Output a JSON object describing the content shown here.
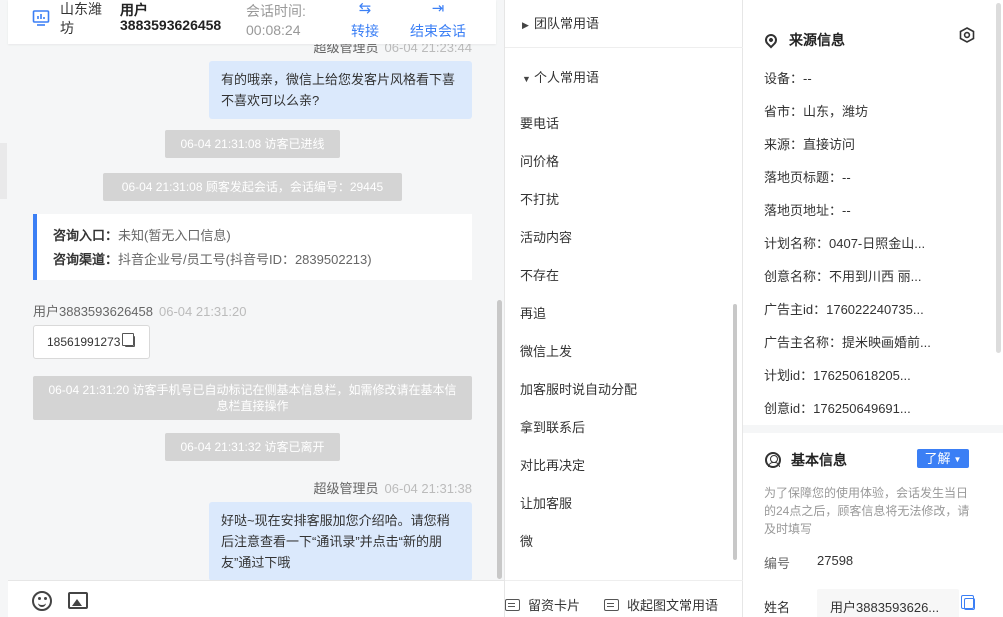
{
  "header": {
    "location": "山东潍坊",
    "user_label": "用户",
    "user_id": "3883593626458",
    "session_time_label": "会话时间:",
    "session_time": "00:08:24",
    "transfer_label": "转接",
    "end_label": "结束会话"
  },
  "messages": {
    "m1_sender": "超级管理员",
    "m1_time": "06-04 21:23:44",
    "m1_text": "有的哦亲，微信上给您发客片风格看下喜不喜欢可以么亲?",
    "sys1": "06-04 21:31:08 访客已进线",
    "sys2": "06-04 21:31:08 顾客发起会话，会话编号：29445",
    "entry_label": "咨询入口：",
    "entry_value": "未知(暂无入口信息)",
    "channel_label": "咨询渠道：",
    "channel_value": "抖音企业号/员工号(抖音号ID：2839502213)",
    "visitor_name": "用户3883593626458",
    "visitor_time": "06-04 21:31:20",
    "visitor_msg": "18561991273",
    "sys3": "06-04 21:31:20 访客手机号已自动标记在侧基本信息栏，如需修改请在基本信息栏直接操作",
    "sys4": "06-04 21:31:32 访客已离开",
    "m2_sender": "超级管理员",
    "m2_time": "06-04 21:31:38",
    "m2_text": "好哒~现在安排客服加您介绍哈。请您稍后注意查看一下“通讯录”并点击“新的朋友”通过下哦"
  },
  "phrases": {
    "team_group": "团队常用语",
    "personal_group": "个人常用语",
    "items": [
      "要电话",
      "问价格",
      "不打扰",
      "活动内容",
      "不存在",
      "再追",
      "微信上发",
      "加客服时说自动分配",
      "拿到联系后",
      "对比再决定",
      "让加客服",
      "微"
    ],
    "footer_card": "留资卡片",
    "footer_collapse": "收起图文常用语"
  },
  "info": {
    "source_title": "来源信息",
    "device": "设备：--",
    "region": "省市：山东，潍坊",
    "origin": "来源：直接访问",
    "landing_title": "落地页标题：--",
    "landing_url": "落地页地址：--",
    "plan_name": "计划名称：0407-日照金山...",
    "creative_name": "创意名称：不用到川西 丽...",
    "advertiser_id": "广告主id：176022240735...",
    "advertiser_name": "广告主名称：提米映画婚前...",
    "plan_id": "计划id：176250618205...",
    "creative_id": "创意id：176250649691...",
    "basic_title": "基本信息",
    "learn_label": "了解",
    "note": "为了保障您的使用体验，会话发生当日的24点之后，顾客信息将无法修改，请及时填写",
    "id_label": "编号",
    "id_value": "27598",
    "name_label": "姓名",
    "name_value": "用户3883593626..."
  },
  "colors": {
    "accent": "#3b7ff5",
    "bubble_me": "#dbe9fc",
    "system_pill": "#d4d4d4"
  }
}
